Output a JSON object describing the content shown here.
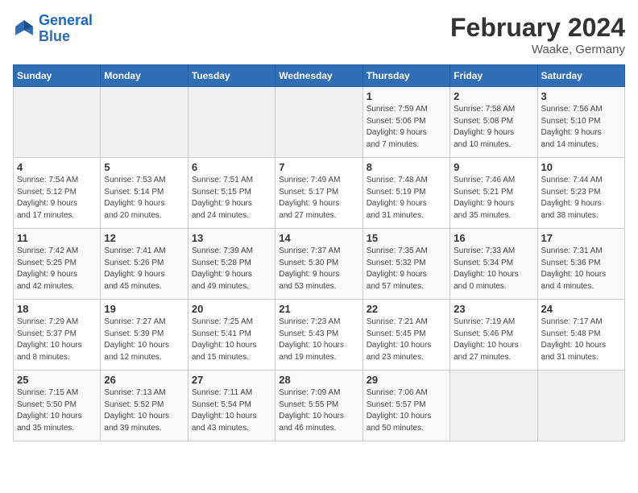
{
  "logo": {
    "text_general": "General",
    "text_blue": "Blue"
  },
  "title": "February 2024",
  "subtitle": "Waake, Germany",
  "days_of_week": [
    "Sunday",
    "Monday",
    "Tuesday",
    "Wednesday",
    "Thursday",
    "Friday",
    "Saturday"
  ],
  "weeks": [
    [
      {
        "day": "",
        "info": ""
      },
      {
        "day": "",
        "info": ""
      },
      {
        "day": "",
        "info": ""
      },
      {
        "day": "",
        "info": ""
      },
      {
        "day": "1",
        "info": "Sunrise: 7:59 AM\nSunset: 5:06 PM\nDaylight: 9 hours\nand 7 minutes."
      },
      {
        "day": "2",
        "info": "Sunrise: 7:58 AM\nSunset: 5:08 PM\nDaylight: 9 hours\nand 10 minutes."
      },
      {
        "day": "3",
        "info": "Sunrise: 7:56 AM\nSunset: 5:10 PM\nDaylight: 9 hours\nand 14 minutes."
      }
    ],
    [
      {
        "day": "4",
        "info": "Sunrise: 7:54 AM\nSunset: 5:12 PM\nDaylight: 9 hours\nand 17 minutes."
      },
      {
        "day": "5",
        "info": "Sunrise: 7:53 AM\nSunset: 5:14 PM\nDaylight: 9 hours\nand 20 minutes."
      },
      {
        "day": "6",
        "info": "Sunrise: 7:51 AM\nSunset: 5:15 PM\nDaylight: 9 hours\nand 24 minutes."
      },
      {
        "day": "7",
        "info": "Sunrise: 7:49 AM\nSunset: 5:17 PM\nDaylight: 9 hours\nand 27 minutes."
      },
      {
        "day": "8",
        "info": "Sunrise: 7:48 AM\nSunset: 5:19 PM\nDaylight: 9 hours\nand 31 minutes."
      },
      {
        "day": "9",
        "info": "Sunrise: 7:46 AM\nSunset: 5:21 PM\nDaylight: 9 hours\nand 35 minutes."
      },
      {
        "day": "10",
        "info": "Sunrise: 7:44 AM\nSunset: 5:23 PM\nDaylight: 9 hours\nand 38 minutes."
      }
    ],
    [
      {
        "day": "11",
        "info": "Sunrise: 7:42 AM\nSunset: 5:25 PM\nDaylight: 9 hours\nand 42 minutes."
      },
      {
        "day": "12",
        "info": "Sunrise: 7:41 AM\nSunset: 5:26 PM\nDaylight: 9 hours\nand 45 minutes."
      },
      {
        "day": "13",
        "info": "Sunrise: 7:39 AM\nSunset: 5:28 PM\nDaylight: 9 hours\nand 49 minutes."
      },
      {
        "day": "14",
        "info": "Sunrise: 7:37 AM\nSunset: 5:30 PM\nDaylight: 9 hours\nand 53 minutes."
      },
      {
        "day": "15",
        "info": "Sunrise: 7:35 AM\nSunset: 5:32 PM\nDaylight: 9 hours\nand 57 minutes."
      },
      {
        "day": "16",
        "info": "Sunrise: 7:33 AM\nSunset: 5:34 PM\nDaylight: 10 hours\nand 0 minutes."
      },
      {
        "day": "17",
        "info": "Sunrise: 7:31 AM\nSunset: 5:36 PM\nDaylight: 10 hours\nand 4 minutes."
      }
    ],
    [
      {
        "day": "18",
        "info": "Sunrise: 7:29 AM\nSunset: 5:37 PM\nDaylight: 10 hours\nand 8 minutes."
      },
      {
        "day": "19",
        "info": "Sunrise: 7:27 AM\nSunset: 5:39 PM\nDaylight: 10 hours\nand 12 minutes."
      },
      {
        "day": "20",
        "info": "Sunrise: 7:25 AM\nSunset: 5:41 PM\nDaylight: 10 hours\nand 15 minutes."
      },
      {
        "day": "21",
        "info": "Sunrise: 7:23 AM\nSunset: 5:43 PM\nDaylight: 10 hours\nand 19 minutes."
      },
      {
        "day": "22",
        "info": "Sunrise: 7:21 AM\nSunset: 5:45 PM\nDaylight: 10 hours\nand 23 minutes."
      },
      {
        "day": "23",
        "info": "Sunrise: 7:19 AM\nSunset: 5:46 PM\nDaylight: 10 hours\nand 27 minutes."
      },
      {
        "day": "24",
        "info": "Sunrise: 7:17 AM\nSunset: 5:48 PM\nDaylight: 10 hours\nand 31 minutes."
      }
    ],
    [
      {
        "day": "25",
        "info": "Sunrise: 7:15 AM\nSunset: 5:50 PM\nDaylight: 10 hours\nand 35 minutes."
      },
      {
        "day": "26",
        "info": "Sunrise: 7:13 AM\nSunset: 5:52 PM\nDaylight: 10 hours\nand 39 minutes."
      },
      {
        "day": "27",
        "info": "Sunrise: 7:11 AM\nSunset: 5:54 PM\nDaylight: 10 hours\nand 43 minutes."
      },
      {
        "day": "28",
        "info": "Sunrise: 7:09 AM\nSunset: 5:55 PM\nDaylight: 10 hours\nand 46 minutes."
      },
      {
        "day": "29",
        "info": "Sunrise: 7:06 AM\nSunset: 5:57 PM\nDaylight: 10 hours\nand 50 minutes."
      },
      {
        "day": "",
        "info": ""
      },
      {
        "day": "",
        "info": ""
      }
    ]
  ]
}
